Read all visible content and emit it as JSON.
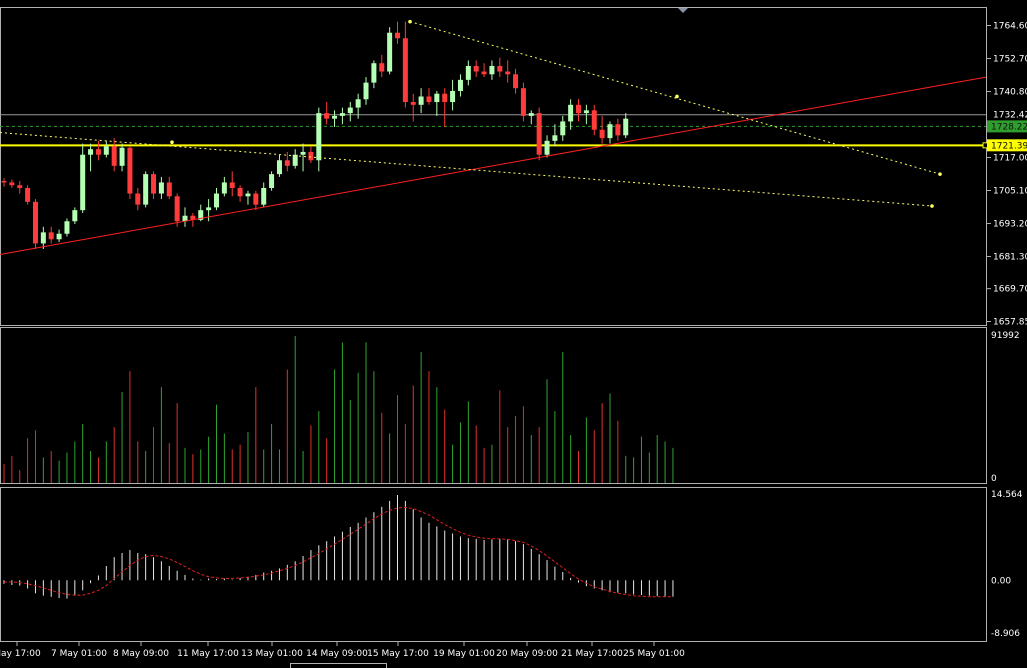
{
  "chart_data": [
    {
      "type": "candlestick",
      "panel": "price",
      "y_ticks": [
        "1764.60",
        "1752.70",
        "1740.80",
        "1728.90",
        "1717.00",
        "1705.10",
        "1693.20",
        "1681.30",
        "1669.70",
        "1657.85"
      ],
      "ylim": [
        1657.85,
        1767.5
      ],
      "current_label": "1732.42",
      "bid_label": "1728.22",
      "hline_label": "1721.39",
      "hline_value": 1721.39,
      "bid_value": 1728.22,
      "current_value": 1732.42,
      "colors": {
        "up": "#b4ffb4",
        "down": "#ff3b3b",
        "hline": "#ffff00",
        "trend": "#ff2020",
        "dotted": "#ffff66",
        "grid": "#5a5a5a"
      },
      "candles": [
        [
          1708.5,
          1709.5,
          1706.5,
          1708.0
        ],
        [
          1708.0,
          1709.0,
          1706.0,
          1707.0
        ],
        [
          1707.0,
          1708.5,
          1704.0,
          1706.0
        ],
        [
          1706.0,
          1707.0,
          1700.0,
          1701.0
        ],
        [
          1701.0,
          1702.0,
          1684.0,
          1686.0
        ],
        [
          1686.0,
          1692.0,
          1684.0,
          1690.0
        ],
        [
          1690.0,
          1692.0,
          1686.0,
          1687.5
        ],
        [
          1687.5,
          1691.0,
          1686.5,
          1689.5
        ],
        [
          1689.5,
          1695.0,
          1688.5,
          1694.0
        ],
        [
          1694.0,
          1699.0,
          1693.0,
          1698.0
        ],
        [
          1698.0,
          1722.0,
          1697.0,
          1718.0
        ],
        [
          1718.0,
          1722.0,
          1712.0,
          1720.0
        ],
        [
          1720.0,
          1723.0,
          1716.0,
          1718.0
        ],
        [
          1718.0,
          1723.0,
          1717.0,
          1721.0
        ],
        [
          1721.0,
          1724.0,
          1712.0,
          1714.0
        ],
        [
          1714.0,
          1722.0,
          1712.0,
          1720.5
        ],
        [
          1720.5,
          1721.0,
          1702.0,
          1704.0
        ],
        [
          1704.0,
          1706.0,
          1698.0,
          1700.0
        ],
        [
          1700.0,
          1712.0,
          1699.0,
          1711.0
        ],
        [
          1711.0,
          1712.0,
          1702.0,
          1704.0
        ],
        [
          1704.0,
          1710.0,
          1702.0,
          1708.0
        ],
        [
          1708.0,
          1710.0,
          1702.0,
          1703.0
        ],
        [
          1703.0,
          1704.0,
          1692.0,
          1694.0
        ],
        [
          1694.0,
          1699.0,
          1692.0,
          1696.0
        ],
        [
          1696.0,
          1697.0,
          1692.0,
          1694.5
        ],
        [
          1694.5,
          1700.0,
          1694.0,
          1698.0
        ],
        [
          1698.0,
          1702.0,
          1694.0,
          1699.0
        ],
        [
          1699.0,
          1706.0,
          1698.0,
          1704.0
        ],
        [
          1704.0,
          1710.0,
          1703.0,
          1708.0
        ],
        [
          1708.0,
          1712.0,
          1703.0,
          1706.0
        ],
        [
          1706.0,
          1707.0,
          1701.0,
          1703.0
        ],
        [
          1703.0,
          1705.0,
          1700.0,
          1704.0
        ],
        [
          1704.0,
          1705.0,
          1698.0,
          1700.0
        ],
        [
          1700.0,
          1708.0,
          1699.0,
          1706.0
        ],
        [
          1706.0,
          1712.0,
          1705.0,
          1711.0
        ],
        [
          1711.0,
          1718.0,
          1710.0,
          1716.0
        ],
        [
          1716.0,
          1719.0,
          1712.0,
          1714.0
        ],
        [
          1714.0,
          1720.0,
          1713.0,
          1718.0
        ],
        [
          1718.0,
          1722.0,
          1712.0,
          1719.0
        ],
        [
          1719.0,
          1721.0,
          1715.0,
          1716.0
        ],
        [
          1716.0,
          1735.0,
          1712.0,
          1733.0
        ],
        [
          1733.0,
          1737.0,
          1729.0,
          1731.0
        ],
        [
          1731.0,
          1734.0,
          1728.0,
          1732.0
        ],
        [
          1732.0,
          1735.0,
          1729.0,
          1733.0
        ],
        [
          1733.0,
          1737.0,
          1730.0,
          1735.0
        ],
        [
          1735.0,
          1740.0,
          1731.0,
          1738.0
        ],
        [
          1738.0,
          1746.0,
          1736.0,
          1744.0
        ],
        [
          1744.0,
          1752.0,
          1742.0,
          1751.0
        ],
        [
          1751.0,
          1754.0,
          1746.0,
          1748.0
        ],
        [
          1748.0,
          1764.0,
          1747.0,
          1762.0
        ],
        [
          1762.0,
          1766.0,
          1758.0,
          1760.0
        ],
        [
          1760.0,
          1766.0,
          1735.0,
          1737.0
        ],
        [
          1737.0,
          1740.0,
          1730.0,
          1736.0
        ],
        [
          1736.0,
          1742.0,
          1733.0,
          1739.0
        ],
        [
          1739.0,
          1742.0,
          1736.0,
          1737.0
        ],
        [
          1737.0,
          1741.0,
          1732.0,
          1740.0
        ],
        [
          1740.0,
          1742.0,
          1728.0,
          1737.0
        ],
        [
          1737.0,
          1745.0,
          1734.0,
          1741.0
        ],
        [
          1741.0,
          1747.0,
          1739.0,
          1745.0
        ],
        [
          1745.0,
          1752.0,
          1743.0,
          1750.0
        ],
        [
          1750.0,
          1752.0,
          1746.0,
          1748.0
        ],
        [
          1748.0,
          1751.0,
          1746.0,
          1747.0
        ],
        [
          1747.0,
          1752.0,
          1745.0,
          1750.0
        ],
        [
          1750.0,
          1753.0,
          1746.0,
          1748.0
        ],
        [
          1748.0,
          1752.0,
          1744.0,
          1747.0
        ],
        [
          1747.0,
          1749.0,
          1740.0,
          1742.0
        ],
        [
          1742.0,
          1744.0,
          1730.0,
          1732.0
        ],
        [
          1732.0,
          1734.0,
          1729.0,
          1733.0
        ],
        [
          1733.0,
          1735.0,
          1716.0,
          1718.0
        ],
        [
          1718.0,
          1725.0,
          1717.0,
          1723.0
        ],
        [
          1723.0,
          1729.0,
          1721.0,
          1725.0
        ],
        [
          1725.0,
          1732.0,
          1723.0,
          1730.0
        ],
        [
          1730.0,
          1738.0,
          1727.0,
          1736.0
        ],
        [
          1736.0,
          1738.0,
          1730.0,
          1733.0
        ],
        [
          1733.0,
          1736.0,
          1729.0,
          1734.0
        ],
        [
          1734.0,
          1736.0,
          1725.0,
          1727.0
        ],
        [
          1727.0,
          1732.0,
          1722.0,
          1724.0
        ],
        [
          1724.0,
          1730.0,
          1722.0,
          1729.0
        ],
        [
          1729.0,
          1731.0,
          1723.0,
          1725.0
        ],
        [
          1725.0,
          1733.0,
          1724.0,
          1731.0
        ]
      ]
    },
    {
      "type": "bar",
      "panel": "volume",
      "y_ticks": [
        "91992",
        "0"
      ],
      "ylim": [
        0,
        91992
      ],
      "values": [
        12000,
        17000,
        8000,
        28000,
        33000,
        16000,
        20000,
        14000,
        19000,
        26000,
        37000,
        20000,
        16000,
        26000,
        35000,
        57000,
        70000,
        26000,
        20000,
        35000,
        60000,
        25000,
        50000,
        22000,
        18000,
        21000,
        29000,
        49000,
        31000,
        21000,
        24000,
        32000,
        60000,
        21000,
        37000,
        21000,
        71000,
        92000,
        20000,
        36000,
        45000,
        28000,
        71000,
        88000,
        52000,
        69000,
        88000,
        70000,
        44000,
        31000,
        55000,
        37000,
        61000,
        82000,
        70000,
        60000,
        46000,
        24000,
        38000,
        51000,
        36000,
        22000,
        24000,
        58000,
        35000,
        42000,
        48000,
        30000,
        35000,
        65000,
        45000,
        82000,
        30000,
        20000,
        41000,
        33000,
        50000,
        56000,
        39000,
        17000,
        16000,
        29000,
        19000,
        30000,
        26000,
        22000
      ]
    },
    {
      "type": "bar",
      "panel": "oscillator",
      "y_ticks": [
        "14.564",
        "0.00",
        "-8.906"
      ],
      "ylim": [
        -8.906,
        14.564
      ],
      "x_tick_labels": [
        "May 17:00",
        "7 May 01:00",
        "8 May 09:00",
        "11 May 17:00",
        "13 May 01:00",
        "14 May 09:00",
        "15 May 17:00",
        "19 May 01:00",
        "20 May 09:00",
        "21 May 17:00",
        "25 May 01:00"
      ],
      "values": [
        -0.6,
        -0.8,
        -0.9,
        -1.4,
        -2.2,
        -2.6,
        -2.8,
        -3.0,
        -3.1,
        -2.6,
        -1.7,
        -0.5,
        0.8,
        2.4,
        3.9,
        4.6,
        5.1,
        4.6,
        4.4,
        3.9,
        3.2,
        2.4,
        1.6,
        0.9,
        0.3,
        0.1,
        0.3,
        0.2,
        0.3,
        0.1,
        0.4,
        0.6,
        0.9,
        1.3,
        1.6,
        2.0,
        2.6,
        3.2,
        4.1,
        5.1,
        5.9,
        6.6,
        7.4,
        8.2,
        9.0,
        9.7,
        10.6,
        11.5,
        12.4,
        13.4,
        14.4,
        13.4,
        12.0,
        10.6,
        9.7,
        9.1,
        8.4,
        7.9,
        7.4,
        7.1,
        7.0,
        6.8,
        6.9,
        7.0,
        6.9,
        6.6,
        6.1,
        5.3,
        4.4,
        3.4,
        2.3,
        1.4,
        0.4,
        -0.4,
        -1.0,
        -1.4,
        -1.7,
        -2.0,
        -2.1,
        -2.2,
        -2.4,
        -2.5,
        -2.6,
        -2.7,
        -2.8,
        -2.8
      ],
      "signal": [
        -0.3,
        -0.3,
        -0.4,
        -0.6,
        -0.9,
        -1.3,
        -1.7,
        -2.1,
        -2.4,
        -2.5,
        -2.5,
        -2.2,
        -1.7,
        -0.9,
        0.3,
        1.4,
        2.5,
        3.4,
        4.0,
        4.2,
        4.0,
        3.6,
        3.0,
        2.3,
        1.6,
        1.0,
        0.6,
        0.4,
        0.3,
        0.3,
        0.4,
        0.5,
        0.7,
        0.9,
        1.2,
        1.6,
        2.0,
        2.5,
        3.1,
        3.8,
        4.5,
        5.3,
        6.1,
        6.9,
        7.8,
        8.6,
        9.5,
        10.4,
        11.2,
        11.8,
        12.2,
        12.3,
        12.1,
        11.6,
        11.0,
        10.2,
        9.4,
        8.7,
        8.1,
        7.6,
        7.3,
        7.1,
        7.0,
        7.0,
        6.9,
        6.7,
        6.4,
        5.8,
        5.0,
        4.1,
        3.1,
        2.1,
        1.1,
        0.2,
        -0.5,
        -1.1,
        -1.5,
        -1.9,
        -2.2,
        -2.4,
        -2.6,
        -2.7,
        -2.8,
        -2.8,
        -2.8,
        -2.8
      ]
    }
  ]
}
